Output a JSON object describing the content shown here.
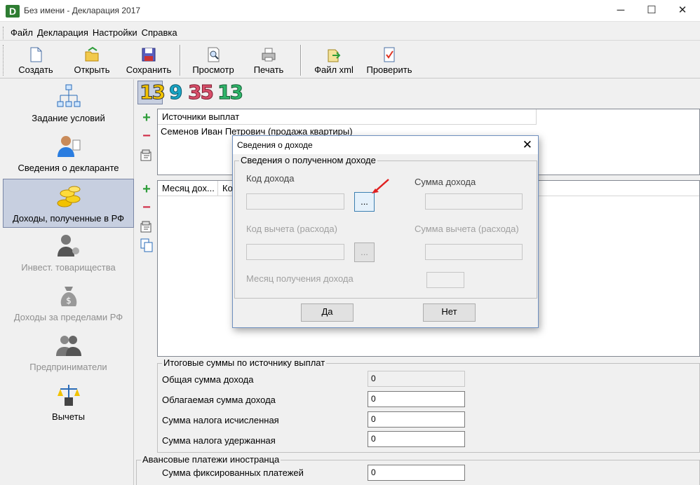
{
  "window": {
    "title": "Без имени - Декларация 2017",
    "app_icon": "D"
  },
  "menu": [
    "Файл",
    "Декларация",
    "Настройки",
    "Справка"
  ],
  "toolbar": {
    "create": "Создать",
    "open": "Открыть",
    "save": "Сохранить",
    "preview": "Просмотр",
    "print": "Печать",
    "xml": "Файл xml",
    "check": "Проверить"
  },
  "left_panel": [
    {
      "label": "Задание условий",
      "icon": "network-icon",
      "state": "enabled"
    },
    {
      "label": "Сведения о декларанте",
      "icon": "person-icon",
      "state": "enabled"
    },
    {
      "label": "Доходы, полученные в РФ",
      "icon": "coins-icon",
      "state": "selected"
    },
    {
      "label": "Инвест. товарищества",
      "icon": "investor-icon",
      "state": "disabled"
    },
    {
      "label": "Доходы за пределами РФ",
      "icon": "money-bag-icon",
      "state": "disabled"
    },
    {
      "label": "Предприниматели",
      "icon": "entrepreneur-icon",
      "state": "disabled"
    },
    {
      "label": "Вычеты",
      "icon": "scales-icon",
      "state": "enabled"
    }
  ],
  "rate_tabs": [
    "13",
    "9",
    "35",
    "13"
  ],
  "sources": {
    "header": "Источники выплат",
    "items": [
      "Семенов Иван Петрович (продажа квартиры)"
    ]
  },
  "incomes": {
    "col1": "Месяц дох...",
    "col2": "Ко"
  },
  "totals": {
    "title": "Итоговые суммы по источнику выплат",
    "total_income_label": "Общая сумма дохода",
    "total_income": "0",
    "taxable_label": "Облагаемая сумма дохода",
    "taxable": "0",
    "tax_calc_label": "Сумма налога исчисленная",
    "tax_calc": "0",
    "tax_withheld_label": "Сумма налога удержанная",
    "tax_withheld": "0"
  },
  "advance": {
    "title": "Авансовые платежи иностранца",
    "fixed_label": "Сумма фиксированных платежей",
    "fixed": "0"
  },
  "dialog": {
    "title": "Сведения о доходе",
    "close": "✕",
    "group": "Сведения о полученном доходе",
    "income_code_label": "Код дохода",
    "income_sum_label": "Сумма дохода",
    "deduction_code_label": "Код вычета (расхода)",
    "deduction_sum_label": "Сумма вычета (расхода)",
    "month_label": "Месяц получения дохода",
    "browse": "...",
    "yes": "Да",
    "no": "Нет"
  }
}
